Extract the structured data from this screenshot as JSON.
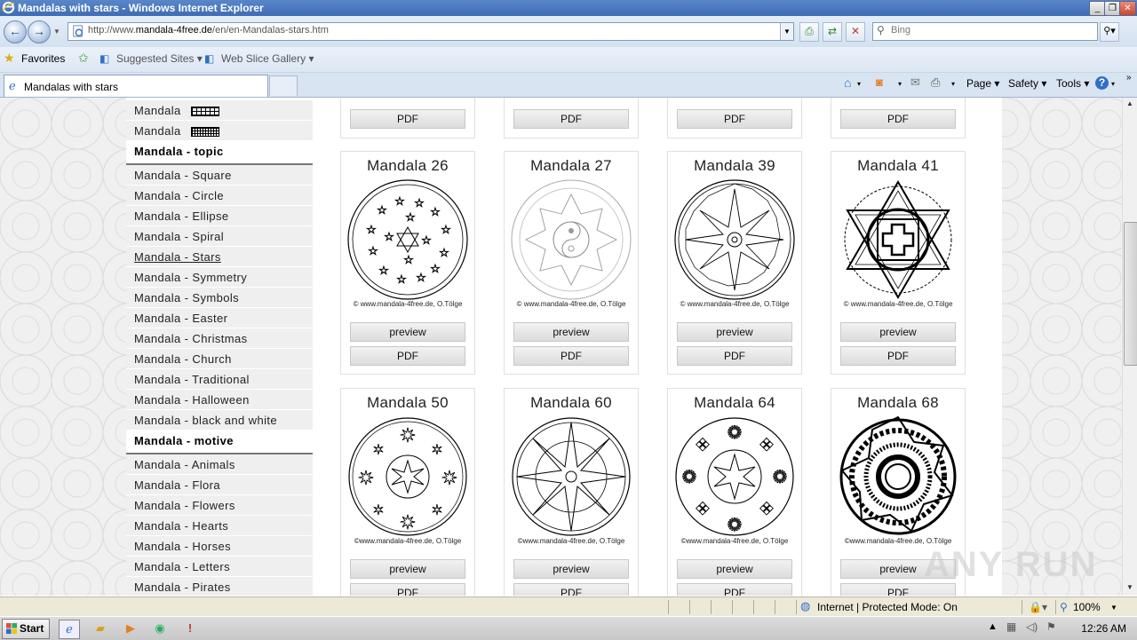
{
  "window": {
    "title": "Mandalas with stars - Windows Internet Explorer",
    "controls": [
      "_",
      "❐",
      "✕"
    ]
  },
  "nav": {
    "back_icon": "back-arrow-icon",
    "forward_icon": "forward-arrow-icon",
    "url_prefix": "http://www.",
    "url_domain": "mandala-4free.de",
    "url_path": "/en/en-Mandalas-stars.htm",
    "search_placeholder": "Bing"
  },
  "favorites_bar": {
    "favorites": "Favorites",
    "suggested": "Suggested Sites ▾",
    "webslice": "Web Slice Gallery ▾"
  },
  "tab": {
    "label": "Mandalas with stars"
  },
  "commands": {
    "page": "Page ▾",
    "safety": "Safety ▾",
    "tools": "Tools ▾"
  },
  "sidebar": {
    "items_top": [
      {
        "label": "Mandala"
      },
      {
        "label": "Mandala"
      }
    ],
    "heading_topic": "Mandala - topic",
    "topic_items": [
      {
        "label": "Mandala - Square"
      },
      {
        "label": "Mandala - Circle"
      },
      {
        "label": "Mandala - Ellipse"
      },
      {
        "label": "Mandala - Spiral"
      },
      {
        "label": "Mandala - Stars"
      },
      {
        "label": "Mandala - Symmetry"
      },
      {
        "label": "Mandala - Symbols"
      },
      {
        "label": "Mandala - Easter"
      },
      {
        "label": "Mandala - Christmas"
      },
      {
        "label": "Mandala - Church"
      },
      {
        "label": "Mandala - Traditional"
      },
      {
        "label": "Mandala - Halloween"
      },
      {
        "label": "Mandala - black and white"
      }
    ],
    "heading_motive": "Mandala - motive",
    "motive_items": [
      {
        "label": "Mandala - Animals"
      },
      {
        "label": "Mandala - Flora"
      },
      {
        "label": "Mandala - Flowers"
      },
      {
        "label": "Mandala - Hearts"
      },
      {
        "label": "Mandala - Horses"
      },
      {
        "label": "Mandala - Letters"
      },
      {
        "label": "Mandala - Pirates"
      }
    ]
  },
  "grid": {
    "copyright": "© www.mandala-4free.de, O.Tölge",
    "copyright_alt": "©www.mandala-4free.de, O.Tölge",
    "preview_label": "preview",
    "pdf_label": "PDF",
    "row1": [
      {
        "title": "Mandala 26"
      },
      {
        "title": "Mandala 27"
      },
      {
        "title": "Mandala 39"
      },
      {
        "title": "Mandala 41"
      }
    ],
    "row2": [
      {
        "title": "Mandala 50"
      },
      {
        "title": "Mandala 60"
      },
      {
        "title": "Mandala 64"
      },
      {
        "title": "Mandala 68"
      }
    ]
  },
  "status": {
    "zone": "Internet | Protected Mode: On",
    "zoom": "100%"
  },
  "taskbar": {
    "start": "Start",
    "clock": "12:26 AM"
  },
  "watermark": "ANY RUN"
}
